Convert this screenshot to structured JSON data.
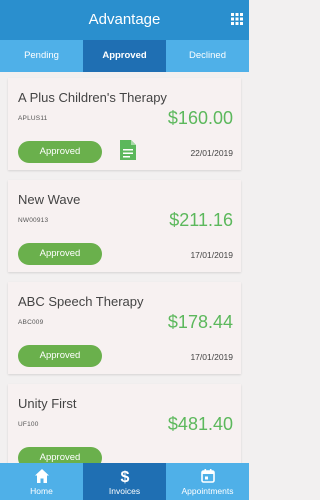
{
  "header": {
    "title": "Advantage",
    "menu_icon": "grid-icon"
  },
  "tabs": [
    {
      "label": "Pending",
      "active": false
    },
    {
      "label": "Approved",
      "active": true
    },
    {
      "label": "Declined",
      "active": false
    }
  ],
  "invoices": [
    {
      "name": "A Plus Children's Therapy",
      "code": "APLUS11",
      "amount": "$160.00",
      "status": "Approved",
      "date": "22/01/2019",
      "has_document": true
    },
    {
      "name": "New Wave",
      "code": "NW00913",
      "amount": "$211.16",
      "status": "Approved",
      "date": "17/01/2019",
      "has_document": false
    },
    {
      "name": "ABC Speech Therapy",
      "code": "ABC009",
      "amount": "$178.44",
      "status": "Approved",
      "date": "17/01/2019",
      "has_document": false
    },
    {
      "name": "Unity First",
      "code": "UF100",
      "amount": "$481.40",
      "status": "Approved",
      "date": "",
      "has_document": false
    }
  ],
  "bottom_nav": [
    {
      "label": "Home",
      "icon": "home-icon",
      "active": false
    },
    {
      "label": "Invoices",
      "icon": "dollar-icon",
      "active": true
    },
    {
      "label": "Appointments",
      "icon": "calendar-icon",
      "active": false
    }
  ],
  "colors": {
    "header": "#2a8fce",
    "tab_bar": "#4fb0e8",
    "tab_active": "#1f6fb3",
    "amount": "#5cb85c",
    "status_button": "#6ab04c"
  }
}
